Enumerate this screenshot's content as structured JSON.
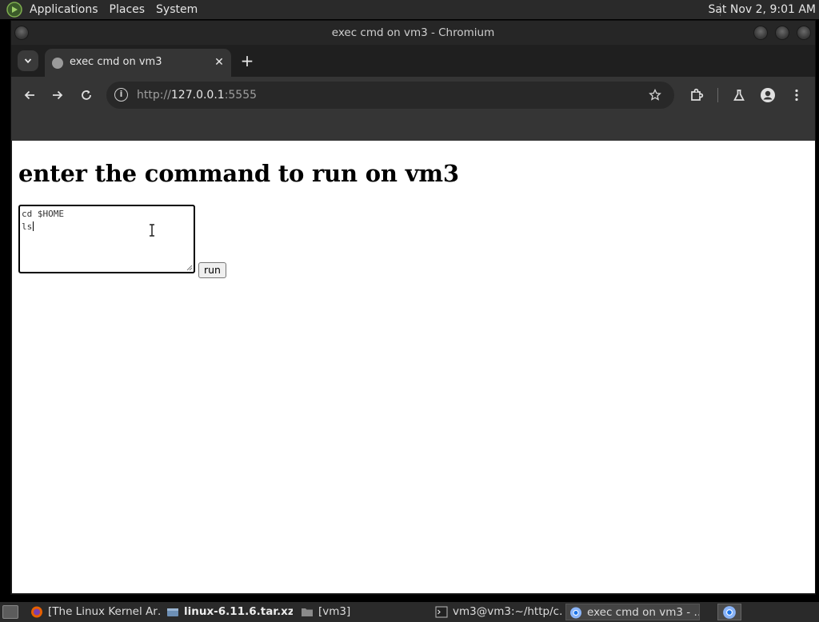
{
  "top_panel": {
    "menus": [
      "Applications",
      "Places",
      "System"
    ],
    "clock": "Sat Nov  2,  9:01 AM"
  },
  "window": {
    "title": "exec cmd on vm3 - Chromium"
  },
  "tab": {
    "title": "exec cmd on vm3",
    "close_glyph": "✕",
    "new_tab_glyph": "+"
  },
  "toolbar": {
    "url_scheme": "http://",
    "url_host": "127.0.0.1",
    "url_rest": ":5555"
  },
  "page": {
    "heading": "enter the command to run on vm3",
    "textarea_value": "cd $HOME\nls",
    "run_label": "run"
  },
  "taskbar": {
    "items": [
      "[The Linux Kernel Ar…",
      "linux-6.11.6.tar.xz",
      "[vm3]",
      "vm3@vm3:~/http/c…",
      "exec cmd on vm3 - …"
    ]
  },
  "colors": {
    "chrome_dark": "#353535",
    "panel": "#2a2a2a",
    "page_bg": "#ffffff"
  }
}
